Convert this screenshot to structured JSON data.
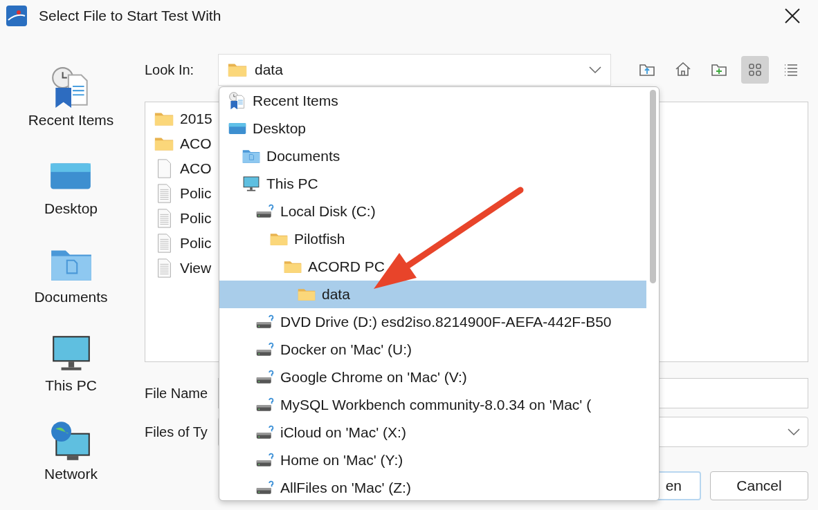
{
  "window": {
    "title": "Select File to Start Test With"
  },
  "sidebar": {
    "items": [
      {
        "label": "Recent Items",
        "kind": "recent"
      },
      {
        "label": "Desktop",
        "kind": "desktop"
      },
      {
        "label": "Documents",
        "kind": "documents"
      },
      {
        "label": "This PC",
        "kind": "pc"
      },
      {
        "label": "Network",
        "kind": "network"
      }
    ]
  },
  "look_in": {
    "label": "Look In:",
    "value": "data"
  },
  "toolbar": {
    "buttons": [
      {
        "kind": "up",
        "selected": false
      },
      {
        "kind": "home",
        "selected": false
      },
      {
        "kind": "new-folder",
        "selected": false
      },
      {
        "kind": "grid",
        "selected": true
      },
      {
        "kind": "list",
        "selected": false
      }
    ]
  },
  "file_list": [
    {
      "name": "2015",
      "kind": "folder"
    },
    {
      "name": "ACO",
      "kind": "folder"
    },
    {
      "name": "ACO",
      "kind": "blank"
    },
    {
      "name": "Polic",
      "kind": "text"
    },
    {
      "name": "Polic",
      "kind": "text"
    },
    {
      "name": "Polic",
      "kind": "text"
    },
    {
      "name": "View",
      "kind": "text"
    }
  ],
  "file_name": {
    "label": "File Name"
  },
  "file_type": {
    "label": "Files of Ty"
  },
  "buttons": [
    {
      "label": "en",
      "kind": "open"
    },
    {
      "label": "Cancel",
      "kind": "cancel"
    }
  ],
  "look_in_menu": {
    "items": [
      {
        "label": "Recent Items",
        "kind": "recent",
        "selected": false
      },
      {
        "label": "Desktop",
        "kind": "desktop",
        "selected": false,
        "children": [
          {
            "label": "Documents",
            "kind": "documents",
            "selected": false
          },
          {
            "label": "This PC",
            "kind": "pc",
            "selected": false,
            "children": [
              {
                "label": "Local Disk (C:)",
                "kind": "drive",
                "selected": false,
                "children": [
                  {
                    "label": "Pilotfish",
                    "kind": "folder",
                    "selected": false,
                    "children": [
                      {
                        "label": "ACORD PC",
                        "kind": "folder",
                        "selected": false,
                        "children": [
                          {
                            "label": "data",
                            "kind": "folder",
                            "selected": true
                          }
                        ]
                      }
                    ]
                  }
                ]
              },
              {
                "label": "DVD Drive (D:) esd2iso.8214900F-AEFA-442F-B50",
                "kind": "drive",
                "selected": false
              },
              {
                "label": "Docker on 'Mac' (U:)",
                "kind": "drive",
                "selected": false
              },
              {
                "label": "Google Chrome on 'Mac' (V:)",
                "kind": "drive",
                "selected": false
              },
              {
                "label": "MySQL Workbench community-8.0.34 on 'Mac' (",
                "kind": "drive",
                "selected": false
              },
              {
                "label": "iCloud on 'Mac' (X:)",
                "kind": "drive",
                "selected": false
              },
              {
                "label": "Home on 'Mac' (Y:)",
                "kind": "drive",
                "selected": false
              },
              {
                "label": "AllFiles on 'Mac' (Z:)",
                "kind": "drive",
                "selected": false
              }
            ]
          }
        ]
      }
    ]
  }
}
